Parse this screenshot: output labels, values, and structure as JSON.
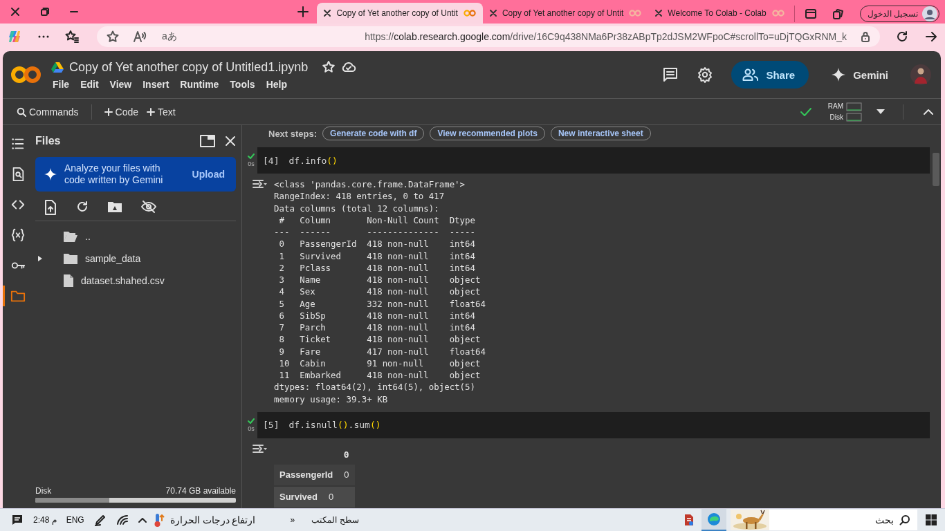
{
  "browser": {
    "tabs": [
      {
        "title": "Copy of Yet another copy of Untit",
        "selected": true
      },
      {
        "title": "Copy of Yet another copy of Untit",
        "selected": false
      },
      {
        "title": "Welcome To Colab - Colab",
        "selected": false
      }
    ],
    "profile": "تسجيل الدخول",
    "translate_glyph": "aあ",
    "address": {
      "scheme": "https://",
      "host": "colab.research.google.com",
      "path": "/drive/16C9q438NMa6Pr38zABpTp2dJSM2WFpoC#scrollTo=uDjTQGxRNM_k"
    }
  },
  "colab": {
    "title": "Copy of Yet another copy of Untitled1.ipynb",
    "menu": [
      "File",
      "Edit",
      "View",
      "Insert",
      "Runtime",
      "Tools",
      "Help"
    ],
    "share": "Share",
    "gemini": "Gemini",
    "toolbar": {
      "commands": "Commands",
      "add_code": "Code",
      "add_text": "Text"
    },
    "runtime": {
      "connected": true,
      "ram": "RAM",
      "disk": "Disk"
    }
  },
  "sidebar": {
    "rail": [
      {
        "kind": "toc",
        "selected": false
      },
      {
        "kind": "find",
        "selected": false
      },
      {
        "kind": "snippets",
        "selected": false
      },
      {
        "kind": "variables",
        "selected": false
      },
      {
        "kind": "secrets",
        "selected": false
      },
      {
        "kind": "files",
        "selected": true
      }
    ],
    "title": "Files",
    "promo": "Analyze your files with code written by Gemini",
    "upload": "Upload",
    "files": [
      {
        "name": "..",
        "kind": "parent"
      },
      {
        "name": "sample_data",
        "kind": "folder",
        "expanded": false
      },
      {
        "name": "dataset.shahed.csv",
        "kind": "file"
      }
    ],
    "disk": {
      "label": "Disk",
      "available": "70.74 GB available",
      "level": 0.37
    }
  },
  "notebook": {
    "next_steps": {
      "label": "Next steps:",
      "chips": [
        "Generate code with df",
        "View recommended plots",
        "New interactive sheet"
      ]
    },
    "cells": [
      {
        "count": "[4]",
        "code": "df.info()",
        "ran": true,
        "time": "0s",
        "output_lines": [
          "<class 'pandas.core.frame.DataFrame'>",
          "RangeIndex: 418 entries, 0 to 417",
          "Data columns (total 12 columns):",
          " #   Column       Non-Null Count  Dtype",
          "---  ------       --------------  -----",
          " 0   PassengerId  418 non-null    int64",
          " 1   Survived     418 non-null    int64",
          " 2   Pclass       418 non-null    int64",
          " 3   Name         418 non-null    object",
          " 4   Sex          418 non-null    object",
          " 5   Age          332 non-null    float64",
          " 6   SibSp        418 non-null    int64",
          " 7   Parch        418 non-null    int64",
          " 8   Ticket       418 non-null    object",
          " 9   Fare         417 non-null    float64",
          " 10  Cabin        91 non-null     object",
          " 11  Embarked     418 non-null    object",
          "dtypes: float64(2), int64(5), object(5)",
          "memory usage: 39.3+ KB"
        ]
      },
      {
        "count": "[5]",
        "code": "df.isnull().sum()",
        "ran": true,
        "time": "0s",
        "table": {
          "column": "0",
          "rows": [
            {
              "label": "PassengerId",
              "value": "0"
            },
            {
              "label": "Survived",
              "value": "0"
            }
          ]
        }
      }
    ]
  },
  "taskbar": {
    "time": "2:48 م",
    "language": "ENG",
    "weather": "ارتفاع درجات الحرارة",
    "desktop": "سطح المكتب",
    "desktop_chevron": "»",
    "search": "بحث"
  }
}
